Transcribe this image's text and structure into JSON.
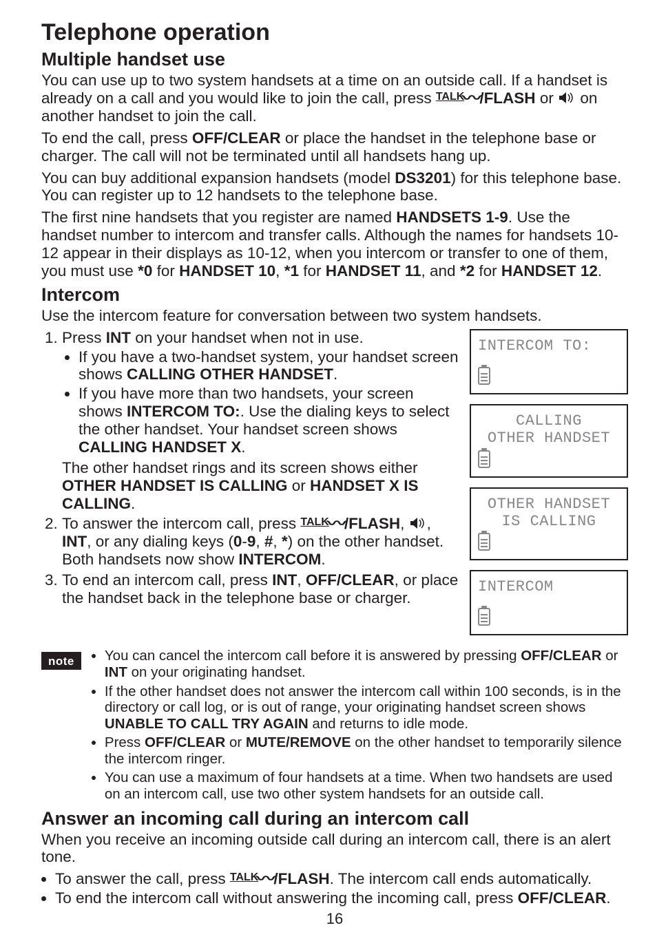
{
  "page_title": "Telephone operation",
  "section1": {
    "heading": "Multiple handset use",
    "p1_a": "You can use up to two system handsets at a time on an outside call. If a handset is already on a call and you would like to join the call, press ",
    "p1_talk": "TALK",
    "p1_flash": "/FLASH",
    "p1_b": " or ",
    "p1_c": " on another handset to join the call.",
    "p2_a": "To end the call, press ",
    "p2_off": "OFF/",
    "p2_clear": "CLEAR",
    "p2_b": " or place the handset in the telephone base or charger. The call will not be terminated until all handsets hang up.",
    "p3_a": "You can buy additional expansion handsets (model ",
    "p3_model": "DS3201",
    "p3_b": ") for this telephone base. You can register up to 12 handsets to the telephone base.",
    "p4_a": "The first nine handsets that you register are named ",
    "p4_b": "HANDSETS 1-9",
    "p4_c": ". Use the handset number to intercom and transfer calls. Although the names for handsets 10-12 appear in their displays as 10-12, when you intercom or transfer to one of them, you must use ",
    "p4_d": "*0",
    "p4_e": " for ",
    "p4_f": "HANDSET 10",
    "p4_g": ", ",
    "p4_h": "*1",
    "p4_i": " for ",
    "p4_j": "HANDSET 11",
    "p4_k": ", and ",
    "p4_l": "*2",
    "p4_m": " for ",
    "p4_n": "HANDSET 12",
    "p4_o": "."
  },
  "section2": {
    "heading": "Intercom",
    "intro": "Use the intercom feature for conversation between two system handsets.",
    "step1_a": "Press ",
    "step1_b": "INT",
    "step1_c": " on your handset when not in use.",
    "step1_bullet1_a": "If you have a two-handset system, your handset screen shows ",
    "step1_bullet1_b": "CALLING OTHER HANDSET",
    "step1_bullet1_c": ".",
    "step1_bullet2_a": "If you have more than two handsets, your screen shows ",
    "step1_bullet2_b": "INTERCOM TO:",
    "step1_bullet2_c": ". Use the dialing keys to select the other handset. Your handset screen shows ",
    "step1_bullet2_d": "CALLING HANDSET X",
    "step1_bullet2_e": ".",
    "step1_note_a": "The other handset rings and its screen shows either ",
    "step1_note_b": "OTHER HANDSET IS CALLING",
    "step1_note_c": " or ",
    "step1_note_d": "HANDSET X IS CALLING",
    "step1_note_e": ".",
    "step2_a": "To answer the intercom call, press ",
    "step2_talk": "TALK",
    "step2_flash": "/FLASH",
    "step2_b": ", ",
    "step2_c": ", ",
    "step2_int": "INT",
    "step2_d": ", or any dialing keys (",
    "step2_e": "0",
    "step2_f": "-",
    "step2_g": "9",
    "step2_h": ", ",
    "step2_i": "#",
    "step2_j": ", ",
    "step2_k": "*",
    "step2_l": ") on the other handset. Both handsets now show ",
    "step2_m": "INTERCOM",
    "step2_n": ".",
    "step3_a": "To end an intercom call, press ",
    "step3_b": "INT",
    "step3_c": ", ",
    "step3_d": "OFF/",
    "step3_e": "CLEAR",
    "step3_f": ", or place the handset back in the telephone base or charger."
  },
  "note": {
    "label": "note",
    "item1_a": "You can cancel the intercom call before it is answered by pressing ",
    "item1_b": "OFF/",
    "item1_c": "CLEAR",
    "item1_d": " or ",
    "item1_e": "INT",
    "item1_f": " on your originating handset.",
    "item2_a": " If the other handset does not answer the intercom call within 100 seconds, is in the directory or call log, or is out of range, your originating handset screen shows ",
    "item2_b": "UNABLE TO CALL TRY AGAIN",
    "item2_c": "  and returns to idle mode.",
    "item3_a": "Press ",
    "item3_b": "OFF/",
    "item3_c": "CLEAR",
    "item3_d": " or ",
    "item3_e": "MUTE/",
    "item3_f": "REMOVE",
    "item3_g": " on the other handset to temporarily silence the intercom ringer.",
    "item4": "You can use a maximum of four handsets at a time. When two handsets are used on an intercom call, use two other system handsets for an outside call."
  },
  "section3": {
    "heading": "Answer an incoming call during an intercom call",
    "intro": "When you receive an incoming outside call during an intercom call, there is an alert tone.",
    "bullet1_a": "To answer the call, press ",
    "bullet1_talk": "TALK",
    "bullet1_flash": "/FLASH",
    "bullet1_b": ". The intercom call ends automatically.",
    "bullet2_a": "To end the intercom call without answering the incoming call, press ",
    "bullet2_b": "OFF/",
    "bullet2_c": "CLEAR",
    "bullet2_d": "."
  },
  "screens": {
    "s1_line1": "INTERCOM TO:",
    "s2_line1": "CALLING",
    "s2_line2": "OTHER HANDSET",
    "s3_line1": "OTHER HANDSET",
    "s3_line2": "IS CALLING",
    "s4_line1": "INTERCOM"
  },
  "page_number": "16"
}
